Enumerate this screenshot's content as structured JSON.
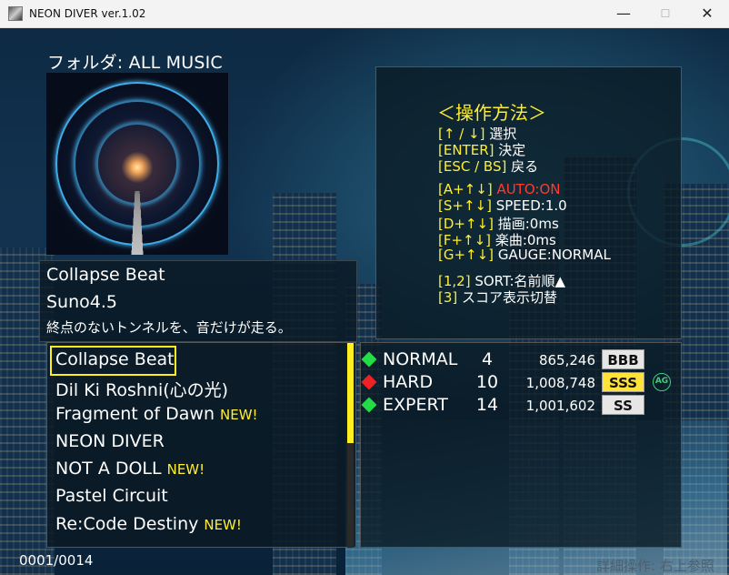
{
  "window": {
    "title": "NEON DIVER ver.1.02",
    "minimize_glyph": "—",
    "maximize_glyph": "☐",
    "close_glyph": "✕"
  },
  "folder": {
    "label": "フォルダ: ALL MUSIC"
  },
  "selected_song": {
    "title": "Collapse Beat",
    "artist": "Suno4.5",
    "description": "終点のないトンネルを、音だけが走る。"
  },
  "song_list": [
    {
      "title": "Collapse Beat",
      "new": ""
    },
    {
      "title": "Dil Ki Roshni(心の光)",
      "new": ""
    },
    {
      "title": "Fragment of Dawn",
      "new": "NEW!"
    },
    {
      "title": "NEON DIVER",
      "new": ""
    },
    {
      "title": "NOT A DOLL",
      "new": "NEW!"
    },
    {
      "title": "Pastel Circuit",
      "new": ""
    },
    {
      "title": "Re:Code Destiny",
      "new": "NEW!"
    }
  ],
  "counter": "0001/0014",
  "hint": "詳細操作: 右上参照",
  "controls": {
    "title": "＜操作方法＞",
    "lines": [
      {
        "key": "[↑ / ↓]",
        "text": " 選択"
      },
      {
        "key": "[ENTER]",
        "text": " 決定"
      },
      {
        "key": "[ESC / BS]",
        "text": " 戻る"
      },
      {
        "key": "[A+↑↓]",
        "text": " AUTO:ON"
      },
      {
        "key": "[S+↑↓]",
        "text": " SPEED:1.0"
      },
      {
        "key": "[D+↑↓]",
        "text": " 描画:0ms"
      },
      {
        "key": "[F+↑↓]",
        "text": " 楽曲:0ms"
      },
      {
        "key": "[G+↑↓]",
        "text": " GAUGE:NORMAL"
      },
      {
        "key": "[1,2]",
        "text": " SORT:名前順▲"
      },
      {
        "key": "[3]",
        "text": " スコア表示切替"
      }
    ]
  },
  "difficulties": [
    {
      "name": "NORMAL",
      "level": "4",
      "score": "865,246",
      "rank": "BBB",
      "color": "#22dd44",
      "badge": ""
    },
    {
      "name": "HARD",
      "level": "10",
      "score": "1,008,748",
      "rank": "SSS",
      "color": "#ee2222",
      "badge": "AG"
    },
    {
      "name": "EXPERT",
      "level": "14",
      "score": "1,001,602",
      "rank": "SS",
      "color": "#22dd44",
      "badge": ""
    }
  ],
  "colors": {
    "accent": "#ffee33",
    "auto_on": "#ff3b30",
    "badge_green": "#3fd07b"
  },
  "icons": {
    "app": "app-icon",
    "minimize": "minimize-icon",
    "maximize": "maximize-icon",
    "close": "close-icon"
  }
}
